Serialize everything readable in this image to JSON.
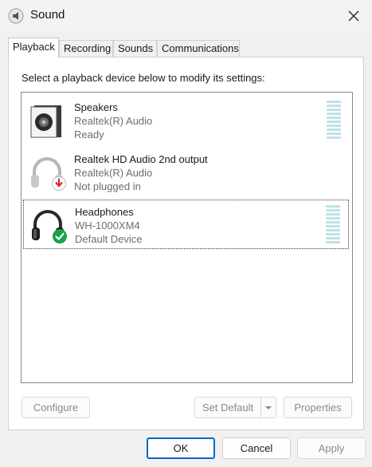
{
  "window": {
    "title": "Sound",
    "icon": "speaker-icon",
    "close_icon": "close-icon"
  },
  "tabs": [
    {
      "label": "Playback",
      "active": true
    },
    {
      "label": "Recording",
      "active": false
    },
    {
      "label": "Sounds",
      "active": false
    },
    {
      "label": "Communications",
      "active": false
    }
  ],
  "playback": {
    "instruction": "Select a playback device below to modify its settings:",
    "devices": [
      {
        "name": "Speakers",
        "driver": "Realtek(R) Audio",
        "status": "Ready",
        "icon": "speakers-icon",
        "badge": "",
        "selected": false,
        "meter": true
      },
      {
        "name": "Realtek HD Audio 2nd output",
        "driver": "Realtek(R) Audio",
        "status": "Not plugged in",
        "icon": "headphones-icon",
        "badge": "unplugged-arrow-icon",
        "selected": false,
        "meter": false
      },
      {
        "name": "Headphones",
        "driver": "WH-1000XM4",
        "status": "Default Device",
        "icon": "headphones-icon",
        "badge": "default-check-icon",
        "selected": true,
        "meter": true
      }
    ],
    "buttons": {
      "configure": "Configure",
      "set_default": "Set Default",
      "properties": "Properties"
    }
  },
  "dialog_buttons": {
    "ok": "OK",
    "cancel": "Cancel",
    "apply": "Apply"
  },
  "colors": {
    "accent": "#0067c0",
    "badge_ok": "#16a34a",
    "badge_unplugged": "#d92c2c",
    "meter": "#bfe3e8"
  }
}
